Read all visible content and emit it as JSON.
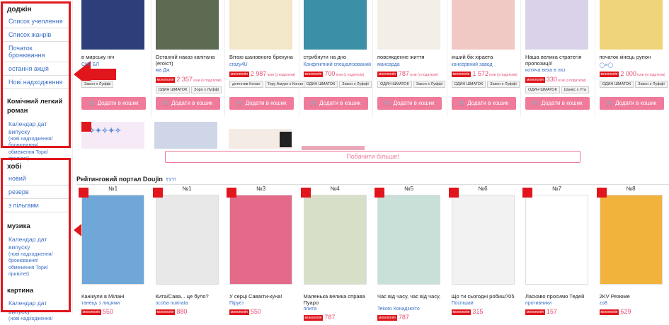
{
  "sidebar": {
    "section1_title": "доджін",
    "links1": [
      "Список учеплення",
      "Список жанрів",
      "Початок бронювання",
      "остання акція",
      "Нові надходження"
    ],
    "section2_title": "Комічний легкий роман",
    "calendar_link": "Календар дат випуску",
    "calendar_note": "(нові надходження/ бронювання/обмеження Тори/ привілеї)",
    "section3_title": "хобі",
    "links3": [
      "новий",
      "резерв",
      "з пільгами"
    ],
    "section4_title": "музика",
    "calendar_link4": "Календар дат випуску",
    "calendar_note4": "(нові надходження/ бронювання/обмеження Тори/ привілеї)",
    "section5_title": "картина",
    "calendar_link5": "Календар дат випуску",
    "calendar_note5": "(нові надходження/"
  },
  "products_row1": [
    {
      "title": "в мирську ніч",
      "circle": "СКР БЛ",
      "price": "",
      "tags": [
        "Закон х Луффі"
      ],
      "cover_color": "#2d3f7a"
    },
    {
      "title": "Останній наказ капітана (егоїст)",
      "circle": "ма Дж",
      "price": "2 357",
      "tags": [
        "ОДИН ШМАТОК",
        "Зоро х Луффі"
      ],
      "cover_color": "#5d6b52"
    },
    {
      "title": "Вітаю шановного брехуна",
      "circle": "crazy4U",
      "price": "2 987",
      "tags": [
        "детектив Конан",
        "Тору Амуро х Конан Едогава"
      ],
      "cover_color": "#f2e7c8"
    },
    {
      "title": "стрибнути на дно",
      "circle": "Конфліктний спеціалізований магазин",
      "price": "700",
      "tags": [
        "ОДИН ШМАТОК",
        "Закон х Луффі"
      ],
      "cover_color": "#3b8fa6"
    },
    {
      "title": "повсякденне життя",
      "circle": "мансарда",
      "price": "787",
      "tags": [
        "ОДИН ШМАТОК",
        "Закон х Луффі"
      ],
      "cover_color": "#f4efe6"
    },
    {
      "title": "інший бік хіраета",
      "circle": "консервний завод",
      "price": "1 572",
      "tags": [
        "ОДИН ШМАТОК",
        "Закон х Луффі"
      ],
      "cover_color": "#f0c8c4"
    },
    {
      "title": "Наша велика стратегія пропозиції!",
      "circle": "котяча веха в лісі",
      "price": "330",
      "tags": [
        "ОДИН ШМАТОК",
        "Шанкс х Ута"
      ],
      "cover_color": "#d9d2e8"
    },
    {
      "title": "початок кінець рупон",
      "circle": "◯×◯",
      "price": "2 000",
      "tags": [
        "ОДИН ШМАТОК",
        "Закон х Луффі"
      ],
      "cover_color": "#f0d47a"
    }
  ],
  "price_badge": "монополія",
  "price_suffix": "ієни (з податком)",
  "cart_label": "Додати в кошик",
  "more_button": "Побачити більше!",
  "portal": {
    "title": "Рейтинговий портал Doujin",
    "link": "ТУТ!"
  },
  "ranking": [
    {
      "rank": "№1",
      "title": "Канікули в Мілані",
      "circle": "танець з лицями",
      "price": "550",
      "cover_color": "#6fa7d8"
    },
    {
      "rank": "№1",
      "title": "Кита/Сава... це було?",
      "circle": "особа nuimata",
      "price": "880",
      "cover_color": "#e8e8e8"
    },
    {
      "rank": "№3",
      "title": "У серці Саваїти-куна!",
      "circle": "Піруєт",
      "price": "550",
      "cover_color": "#e46a8a"
    },
    {
      "rank": "№4",
      "title": "Маленька велика справа Пуаро",
      "circle": "плита",
      "price": "787",
      "cover_color": "#d8dfc9"
    },
    {
      "rank": "№5",
      "title": "Час від часу, час від часу,",
      "circle": "Tekoto Конадзюїто",
      "price": "787",
      "cover_color": "#c9e0d8"
    },
    {
      "rank": "№6",
      "title": "Що ти сьогодні робиш?05",
      "circle": "Поспішай",
      "price": "315",
      "cover_color": "#f2f2f2"
    },
    {
      "rank": "№7",
      "title": "Ласкаво просимо Тедей",
      "circle": "противники",
      "price": "157",
      "cover_color": "#ffffff"
    },
    {
      "rank": "№8",
      "title": "2KV Резюме",
      "circle": "zo8",
      "price": "629",
      "cover_color": "#f2b33d"
    }
  ]
}
